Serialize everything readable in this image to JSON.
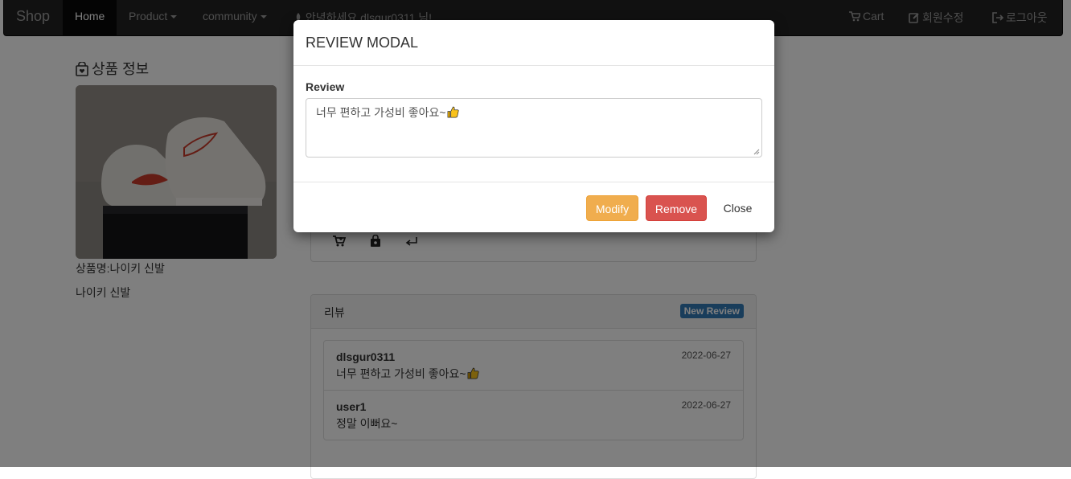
{
  "navbar": {
    "brand": "Shop",
    "home": "Home",
    "product": "Product",
    "community": "community",
    "greeting": "안녕하세요 dlsgur0311 님!",
    "cart": "Cart",
    "edit_member": "회원수정",
    "logout": "로그아웃"
  },
  "product": {
    "section_title": "상품 정보",
    "name_line": "상품명:나이키 신발",
    "description": "나이키 신발"
  },
  "reviews": {
    "title": "리뷰",
    "new_review": "New Review",
    "items": [
      {
        "author": "dlsgur0311",
        "date": "2022-06-27",
        "text": "너무 편하고 가성비 좋아요~",
        "emoji": "thumbs-up-icon"
      },
      {
        "author": "user1",
        "date": "2022-06-27",
        "text": "정말 이뻐요~"
      }
    ]
  },
  "modal": {
    "title": "REVIEW MODAL",
    "label": "Review",
    "textarea_value": "너무 편하고 가성비 좋아요~",
    "textarea_emoji": "thumbs-up-icon",
    "modify": "Modify",
    "remove": "Remove",
    "close": "Close"
  },
  "colors": {
    "modify": "#f0ad4e",
    "remove": "#d9534f",
    "badge": "#337ab7",
    "navbar": "#222222"
  }
}
